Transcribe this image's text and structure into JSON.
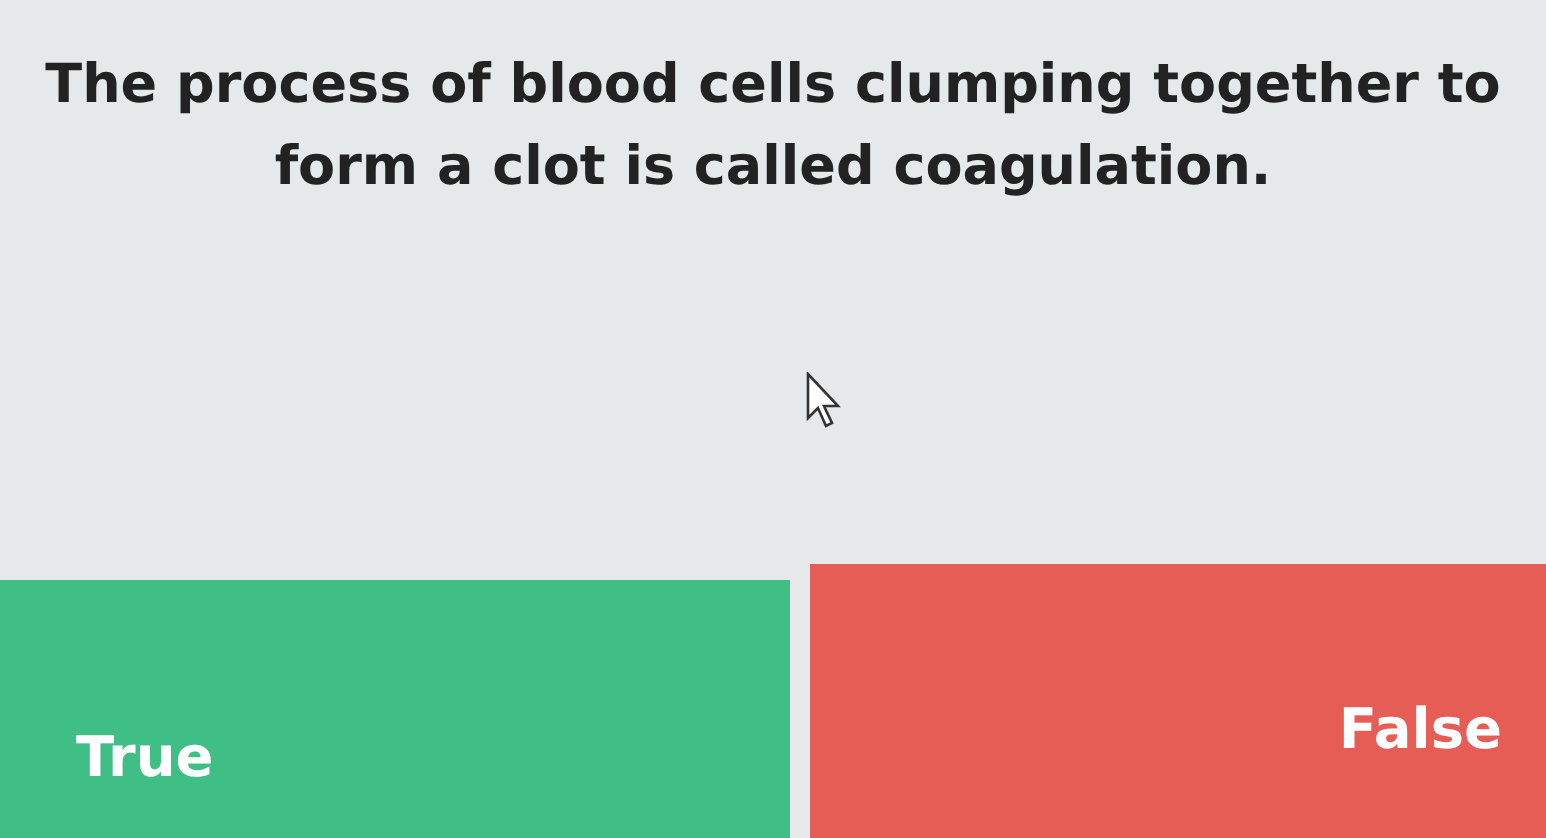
{
  "question": "The process of blood cells clumping together to form a clot is called coagulation.",
  "answers": [
    {
      "label": "True",
      "color": "#3fbf86"
    },
    {
      "label": "False",
      "color": "#e65d56"
    }
  ]
}
